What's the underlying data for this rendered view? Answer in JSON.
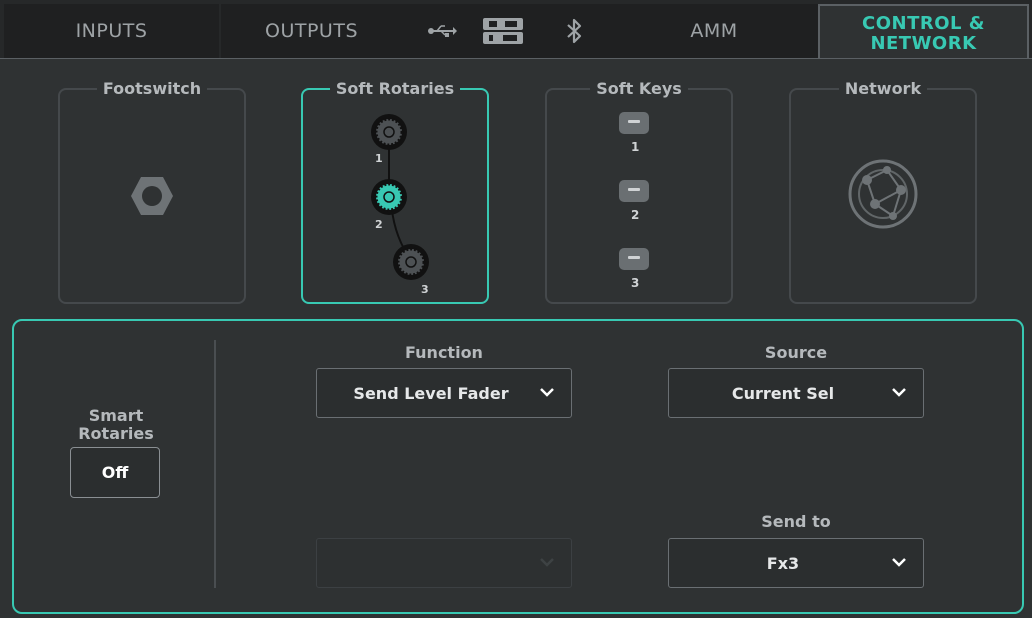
{
  "tabs": {
    "inputs": "INPUTS",
    "outputs": "OUTPUTS",
    "amm": "AMM",
    "control_line1": "CONTROL &",
    "control_line2": "NETWORK"
  },
  "icons": [
    "usb-icon",
    "sdhc-icon",
    "bluetooth-icon"
  ],
  "cards": {
    "footswitch": "Footswitch",
    "soft_rotaries": "Soft Rotaries",
    "soft_keys": "Soft Keys",
    "network": "Network"
  },
  "rotary_numbers": [
    "1",
    "2",
    "3"
  ],
  "key_numbers": [
    "1",
    "2",
    "3"
  ],
  "panel": {
    "smart_rotaries_line1": "Smart",
    "smart_rotaries_line2": "Rotaries",
    "smart_rotaries_value": "Off",
    "function_label": "Function",
    "function_value": "Send Level Fader",
    "source_label": "Source",
    "source_value": "Current Sel",
    "send_to_label": "Send to",
    "send_to_value": "Fx3"
  },
  "colors": {
    "accent": "#38c9b3",
    "background": "#2f3233",
    "tab_background": "#1f2021"
  }
}
